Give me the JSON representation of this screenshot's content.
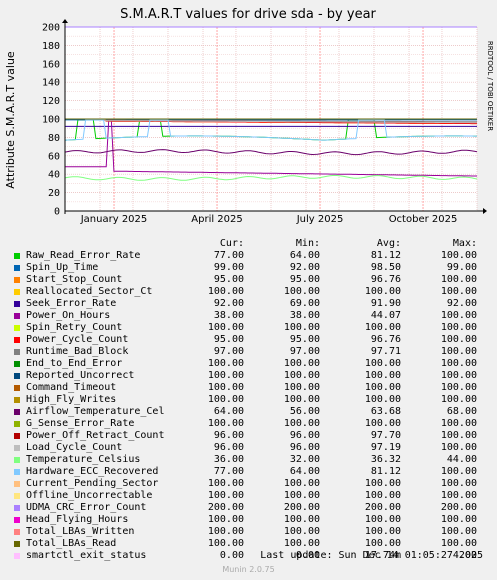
{
  "title": "S.M.A.R.T values for drive sda - by year",
  "ylabel": "Attribute S.M.A.R.T value",
  "watermark": "RRDTOOL / TOBI OETIKER",
  "columns": [
    "Cur:",
    "Min:",
    "Avg:",
    "Max:"
  ],
  "last_update": "Last update: Sun Dec 14 01:05:27 2025",
  "munin_version": "Munin 2.0.75",
  "chart_data": {
    "type": "line",
    "title": "S.M.A.R.T values for drive sda - by year",
    "ylabel": "Attribute S.M.A.R.T value",
    "ylim": [
      0,
      200
    ],
    "yticks": [
      0,
      20,
      40,
      60,
      80,
      100,
      120,
      140,
      160,
      180,
      200
    ],
    "xticks": [
      "January 2025",
      "April 2025",
      "July 2025",
      "October 2025"
    ],
    "grid": true,
    "series": [
      {
        "name": "Raw_Read_Error_Rate",
        "color": "#00cc00",
        "cur": "77.00",
        "min": "64.00",
        "avg": "81.12",
        "max": "100.00"
      },
      {
        "name": "Spin_Up_Time",
        "color": "#0066b3",
        "cur": "99.00",
        "min": "92.00",
        "avg": "98.50",
        "max": "99.00"
      },
      {
        "name": "Start_Stop_Count",
        "color": "#ff8000",
        "cur": "95.00",
        "min": "95.00",
        "avg": "96.76",
        "max": "100.00"
      },
      {
        "name": "Reallocated_Sector_Ct",
        "color": "#ffcc00",
        "cur": "100.00",
        "min": "100.00",
        "avg": "100.00",
        "max": "100.00"
      },
      {
        "name": "Seek_Error_Rate",
        "color": "#330099",
        "cur": "92.00",
        "min": "69.00",
        "avg": "91.90",
        "max": "92.00"
      },
      {
        "name": "Power_On_Hours",
        "color": "#990099",
        "cur": "38.00",
        "min": "38.00",
        "avg": "44.07",
        "max": "100.00"
      },
      {
        "name": "Spin_Retry_Count",
        "color": "#ccff00",
        "cur": "100.00",
        "min": "100.00",
        "avg": "100.00",
        "max": "100.00"
      },
      {
        "name": "Power_Cycle_Count",
        "color": "#ff0000",
        "cur": "95.00",
        "min": "95.00",
        "avg": "96.76",
        "max": "100.00"
      },
      {
        "name": "Runtime_Bad_Block",
        "color": "#808080",
        "cur": "97.00",
        "min": "97.00",
        "avg": "97.71",
        "max": "100.00"
      },
      {
        "name": "End_to_End_Error",
        "color": "#008f00",
        "cur": "100.00",
        "min": "100.00",
        "avg": "100.00",
        "max": "100.00"
      },
      {
        "name": "Reported_Uncorrect",
        "color": "#00487d",
        "cur": "100.00",
        "min": "100.00",
        "avg": "100.00",
        "max": "100.00"
      },
      {
        "name": "Command_Timeout",
        "color": "#b35a00",
        "cur": "100.00",
        "min": "100.00",
        "avg": "100.00",
        "max": "100.00"
      },
      {
        "name": "High_Fly_Writes",
        "color": "#b38f00",
        "cur": "100.00",
        "min": "100.00",
        "avg": "100.00",
        "max": "100.00"
      },
      {
        "name": "Airflow_Temperature_Cel",
        "color": "#6b006b",
        "cur": "64.00",
        "min": "56.00",
        "avg": "63.68",
        "max": "68.00"
      },
      {
        "name": "G_Sense_Error_Rate",
        "color": "#8fb300",
        "cur": "100.00",
        "min": "100.00",
        "avg": "100.00",
        "max": "100.00"
      },
      {
        "name": "Power_Off_Retract_Count",
        "color": "#b30000",
        "cur": "96.00",
        "min": "96.00",
        "avg": "97.70",
        "max": "100.00"
      },
      {
        "name": "Load_Cycle_Count",
        "color": "#bebebe",
        "cur": "96.00",
        "min": "96.00",
        "avg": "97.19",
        "max": "100.00"
      },
      {
        "name": "Temperature_Celsius",
        "color": "#80ff80",
        "cur": "36.00",
        "min": "32.00",
        "avg": "36.32",
        "max": "44.00"
      },
      {
        "name": "Hardware_ECC_Recovered",
        "color": "#80c9ff",
        "cur": "77.00",
        "min": "64.00",
        "avg": "81.12",
        "max": "100.00"
      },
      {
        "name": "Current_Pending_Sector",
        "color": "#ffc080",
        "cur": "100.00",
        "min": "100.00",
        "avg": "100.00",
        "max": "100.00"
      },
      {
        "name": "Offline_Uncorrectable",
        "color": "#ffe680",
        "cur": "100.00",
        "min": "100.00",
        "avg": "100.00",
        "max": "100.00"
      },
      {
        "name": "UDMA_CRC_Error_Count",
        "color": "#aa80ff",
        "cur": "200.00",
        "min": "200.00",
        "avg": "200.00",
        "max": "200.00"
      },
      {
        "name": "Head_Flying_Hours",
        "color": "#ee00cc",
        "cur": "100.00",
        "min": "100.00",
        "avg": "100.00",
        "max": "100.00"
      },
      {
        "name": "Total_LBAs_Written",
        "color": "#ff8080",
        "cur": "100.00",
        "min": "100.00",
        "avg": "100.00",
        "max": "100.00"
      },
      {
        "name": "Total_LBAs_Read",
        "color": "#666600",
        "cur": "100.00",
        "min": "100.00",
        "avg": "100.00",
        "max": "100.00"
      },
      {
        "name": "smartctl_exit_status",
        "color": "#ffbfff",
        "cur": "0.00",
        "min": "0.00",
        "avg": "17.74m",
        "max": "4.00"
      }
    ]
  }
}
